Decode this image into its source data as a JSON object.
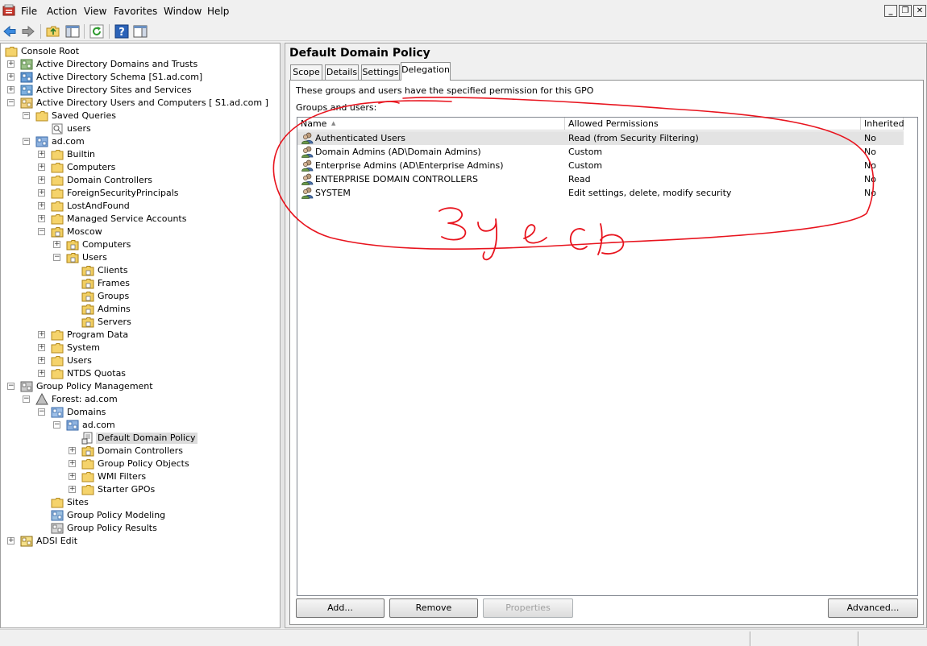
{
  "menubar": {
    "items": [
      "File",
      "Action",
      "View",
      "Favorites",
      "Window",
      "Help"
    ]
  },
  "window_controls": {
    "minimize": "_",
    "restore": "❐",
    "close": "✕"
  },
  "toolbar": {
    "buttons": [
      "back-icon",
      "forward-icon",
      "up-folder-icon",
      "show-hide-tree-icon",
      "refresh-icon",
      "help-icon",
      "action-pane-icon"
    ]
  },
  "tree": {
    "nodes": [
      {
        "label": "Console Root",
        "expander": "",
        "icon": "folder-icon"
      },
      {
        "label": "Active Directory Domains and Trusts",
        "expander": "+",
        "icon": "domains-trusts-icon"
      },
      {
        "label": "Active Directory Schema [S1.ad.com]",
        "expander": "+",
        "icon": "schema-icon"
      },
      {
        "label": "Active Directory Sites and Services",
        "expander": "+",
        "icon": "sites-services-icon"
      },
      {
        "label": "Active Directory Users and Computers [ S1.ad.com ]",
        "expander": "−",
        "icon": "users-computers-icon"
      },
      {
        "label": "Saved Queries",
        "expander": "−",
        "icon": "folder-icon"
      },
      {
        "label": "users",
        "expander": "",
        "icon": "query-icon"
      },
      {
        "label": "ad.com",
        "expander": "−",
        "icon": "domain-icon"
      },
      {
        "label": "Builtin",
        "expander": "+",
        "icon": "folder-icon"
      },
      {
        "label": "Computers",
        "expander": "+",
        "icon": "folder-icon"
      },
      {
        "label": "Domain Controllers",
        "expander": "+",
        "icon": "folder-icon"
      },
      {
        "label": "ForeignSecurityPrincipals",
        "expander": "+",
        "icon": "folder-icon"
      },
      {
        "label": "LostAndFound",
        "expander": "+",
        "icon": "folder-icon"
      },
      {
        "label": "Managed Service Accounts",
        "expander": "+",
        "icon": "folder-icon"
      },
      {
        "label": "Moscow",
        "expander": "−",
        "icon": "ou-icon"
      },
      {
        "label": "Computers",
        "expander": "+",
        "icon": "ou-icon"
      },
      {
        "label": "Users",
        "expander": "−",
        "icon": "ou-icon"
      },
      {
        "label": "Clients",
        "expander": "",
        "icon": "ou-icon"
      },
      {
        "label": "Frames",
        "expander": "",
        "icon": "ou-icon"
      },
      {
        "label": "Groups",
        "expander": "",
        "icon": "ou-icon"
      },
      {
        "label": "Admins",
        "expander": "",
        "icon": "ou-icon"
      },
      {
        "label": "Servers",
        "expander": "",
        "icon": "ou-icon"
      },
      {
        "label": "Program Data",
        "expander": "+",
        "icon": "folder-icon"
      },
      {
        "label": "System",
        "expander": "+",
        "icon": "folder-icon"
      },
      {
        "label": "Users",
        "expander": "+",
        "icon": "folder-icon"
      },
      {
        "label": "NTDS Quotas",
        "expander": "+",
        "icon": "folder-icon"
      },
      {
        "label": "Group Policy Management",
        "expander": "−",
        "icon": "gpm-icon"
      },
      {
        "label": "Forest: ad.com",
        "expander": "−",
        "icon": "forest-icon"
      },
      {
        "label": "Domains",
        "expander": "−",
        "icon": "domains-icon"
      },
      {
        "label": "ad.com",
        "expander": "−",
        "icon": "domain-icon"
      },
      {
        "label": "Default Domain Policy",
        "expander": "",
        "icon": "gpo-link-icon"
      },
      {
        "label": "Domain Controllers",
        "expander": "+",
        "icon": "ou-icon"
      },
      {
        "label": "Group Policy Objects",
        "expander": "+",
        "icon": "gpo-folder-icon"
      },
      {
        "label": "WMI Filters",
        "expander": "+",
        "icon": "wmi-filter-icon"
      },
      {
        "label": "Starter GPOs",
        "expander": "+",
        "icon": "starter-gpo-icon"
      },
      {
        "label": "Sites",
        "expander": "",
        "icon": "sites-icon"
      },
      {
        "label": "Group Policy Modeling",
        "expander": "",
        "icon": "gp-modeling-icon"
      },
      {
        "label": "Group Policy Results",
        "expander": "",
        "icon": "gp-results-icon"
      },
      {
        "label": "ADSI Edit",
        "expander": "+",
        "icon": "adsi-edit-icon"
      }
    ]
  },
  "details": {
    "title": "Default Domain Policy",
    "tabs": [
      "Scope",
      "Details",
      "Settings",
      "Delegation"
    ],
    "active_tab": "Delegation",
    "description": "These groups and users have the specified permission for this GPO",
    "groups_label": "Groups and users:",
    "columns": [
      "Name",
      "Allowed Permissions",
      "Inherited"
    ],
    "sort_indicator": "▲",
    "rows": [
      {
        "name": "Authenticated Users",
        "permissions": "Read (from Security Filtering)",
        "inherited": "No"
      },
      {
        "name": "Domain Admins (AD\\Domain Admins)",
        "permissions": "Custom",
        "inherited": "No"
      },
      {
        "name": "Enterprise Admins (AD\\Enterprise Admins)",
        "permissions": "Custom",
        "inherited": "No"
      },
      {
        "name": "ENTERPRISE DOMAIN CONTROLLERS",
        "permissions": "Read",
        "inherited": "No"
      },
      {
        "name": "SYSTEM",
        "permissions": "Edit settings, delete, modify security",
        "inherited": "No"
      }
    ],
    "buttons": {
      "add": "Add...",
      "remove": "Remove",
      "properties": "Properties",
      "advanced": "Advanced..."
    }
  },
  "annotation": {
    "handwritten_text": "3 y e c b",
    "stroke_color": "#e8141e"
  },
  "colors": {
    "selection": "#e3e3e3",
    "pane_border": "#a0a0a0"
  }
}
